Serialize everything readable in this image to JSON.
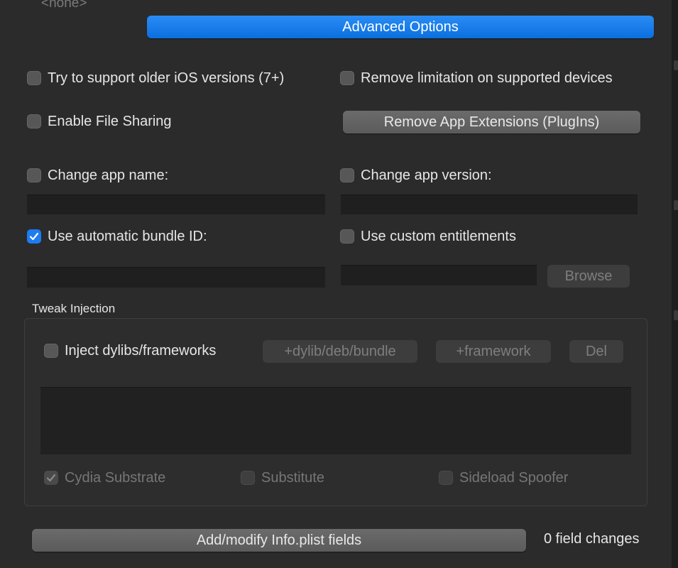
{
  "top": {
    "none_label": "<none>"
  },
  "advanced_button": "Advanced Options",
  "options": {
    "older_ios": {
      "label": "Try to support older iOS versions (7+)",
      "checked": false
    },
    "remove_limitation": {
      "label": "Remove limitation on supported devices",
      "checked": false
    },
    "file_sharing": {
      "label": "Enable File Sharing",
      "checked": false
    },
    "remove_extensions_button": "Remove App Extensions (PlugIns)",
    "change_name": {
      "label": "Change app name:",
      "checked": false,
      "value": ""
    },
    "change_version": {
      "label": "Change app version:",
      "checked": false,
      "value": ""
    },
    "auto_bundle_id": {
      "label": "Use automatic bundle ID:",
      "checked": true,
      "value": ""
    },
    "custom_entitlements": {
      "label": "Use custom entitlements",
      "checked": false,
      "value": ""
    },
    "browse_button": "Browse"
  },
  "tweak": {
    "group_title": "Tweak Injection",
    "inject": {
      "label": "Inject dylibs/frameworks",
      "checked": false
    },
    "add_dylib_button": "+dylib/deb/bundle",
    "add_framework_button": "+framework",
    "del_button": "Del",
    "items": [],
    "cydia_substrate": {
      "label": "Cydia Substrate",
      "checked": true,
      "enabled": false
    },
    "substitute": {
      "label": "Substitute",
      "checked": false,
      "enabled": false
    },
    "sideload_spoofer": {
      "label": "Sideload Spoofer",
      "checked": false,
      "enabled": false
    }
  },
  "footer": {
    "plist_button": "Add/modify Info.plist fields",
    "changes_label": "0 field changes"
  },
  "colors": {
    "accent": "#1d7cf2",
    "background": "#2b2b2b",
    "field": "#1f1f1f"
  }
}
